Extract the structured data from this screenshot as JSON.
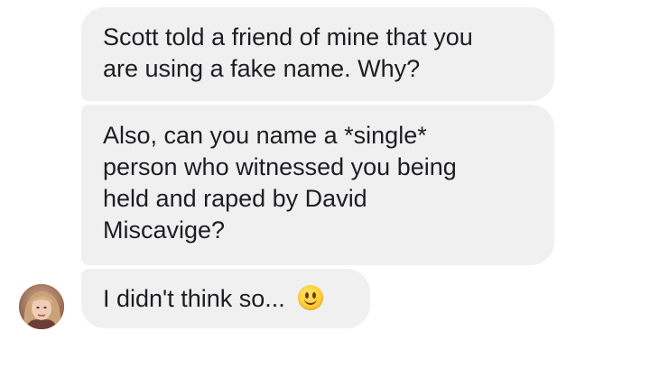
{
  "messages": [
    {
      "lines": [
        "Scott told a friend of mine that you",
        "are using a fake name. Why?"
      ]
    },
    {
      "lines": [
        "Also, can you name a *single*",
        "person who witnessed you being",
        "held and raped by David",
        "Miscavige?"
      ]
    },
    {
      "lines": [
        "I didn't think so..."
      ],
      "emoji": "slightly-smiling-face"
    }
  ],
  "avatar": {
    "icon": "profile-photo"
  },
  "colors": {
    "bubble_background": "#f1f0f0",
    "text": "#1c1e21",
    "page_background": "#ffffff"
  }
}
